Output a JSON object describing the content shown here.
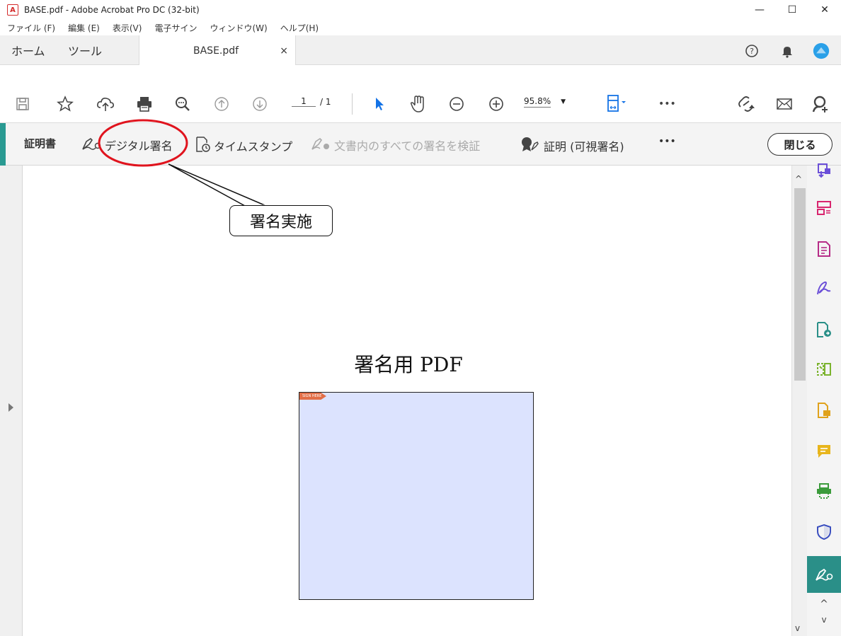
{
  "window": {
    "title": "BASE.pdf - Adobe Acrobat Pro DC (32-bit)",
    "minimize": "—",
    "maximize": "☐",
    "close": "✕"
  },
  "menu": [
    "ファイル (F)",
    "編集 (E)",
    "表示(V)",
    "電子サイン",
    "ウィンドウ(W)",
    "ヘルプ(H)"
  ],
  "tabs": {
    "home": "ホーム",
    "tools": "ツール",
    "doc": "BASE.pdf",
    "doc_close": "×"
  },
  "toolbar": {
    "page_current": "1",
    "page_total": "/ 1",
    "zoom": "95.8%",
    "more": "•••"
  },
  "cert_bar": {
    "title": "証明書",
    "digital_sign": "デジタル署名",
    "timestamp": "タイムスタンプ",
    "verify_all": "文書内のすべての署名を検証",
    "certify_visible": "証明 (可視署名)",
    "more": "•••",
    "close": "閉じる"
  },
  "document": {
    "heading": "署名用 PDF",
    "flag_text": "SIGN HERE"
  },
  "annotation": {
    "callout_text": "署名実施",
    "circle_color": "#e0141e"
  },
  "colors": {
    "accent": "#2a9a92",
    "signature_box": "#dce3fe",
    "flag": "#e26e47"
  },
  "icons": {
    "toolbar": [
      "save-icon",
      "star-icon",
      "cloud-upload-icon",
      "print-icon",
      "zoom-search-icon",
      "page-up-icon",
      "page-down-icon",
      "select-cursor-icon",
      "hand-icon",
      "zoom-out-icon",
      "zoom-in-icon",
      "fit-page-icon",
      "link-icon",
      "mail-icon",
      "share-user-icon"
    ],
    "right_panel": [
      "export-pdf-icon",
      "organize-pages-icon",
      "edit-pdf-icon",
      "fill-sign-icon",
      "create-pdf-icon",
      "compare-icon",
      "export-icon",
      "comment-icon",
      "scan-icon",
      "protect-icon",
      "certificates-icon"
    ]
  }
}
